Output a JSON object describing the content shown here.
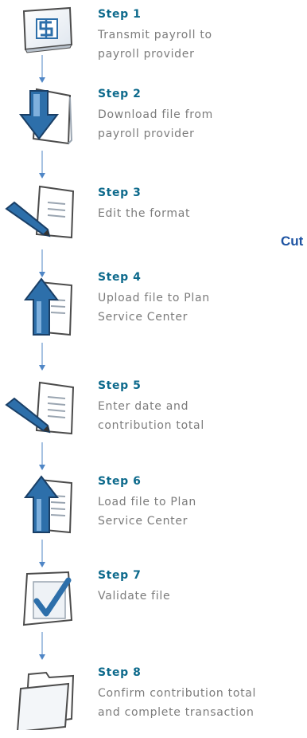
{
  "steps": [
    {
      "title": "Step 1",
      "desc": "Transmit payroll to\npayroll provider",
      "icon": "dollar-sign-icon"
    },
    {
      "title": "Step 2",
      "desc": "Download file from\npayroll provider",
      "icon": "download-arrow-icon"
    },
    {
      "title": "Step 3",
      "desc": "Edit the format",
      "icon": "pencil-document-icon"
    },
    {
      "title": "Step 4",
      "desc": "Upload file to Plan\nService Center",
      "icon": "upload-arrow-icon"
    },
    {
      "title": "Step 5",
      "desc": "Enter date and\ncontribution total",
      "icon": "pencil-document-icon"
    },
    {
      "title": "Step 6",
      "desc": "Load file to Plan\nService Center",
      "icon": "upload-arrow-icon"
    },
    {
      "title": "Step 7",
      "desc": "Validate file",
      "icon": "checkmark-document-icon"
    },
    {
      "title": "Step 8",
      "desc": "Confirm contribution total\nand complete transaction",
      "icon": "folder-icon"
    }
  ],
  "side_label": "Cut",
  "colors": {
    "title": "#0d6a8c",
    "desc": "#7c7c7c",
    "side": "#1d53a2",
    "icon_blue": "#2d6faa",
    "connector": "#4f86c6"
  }
}
